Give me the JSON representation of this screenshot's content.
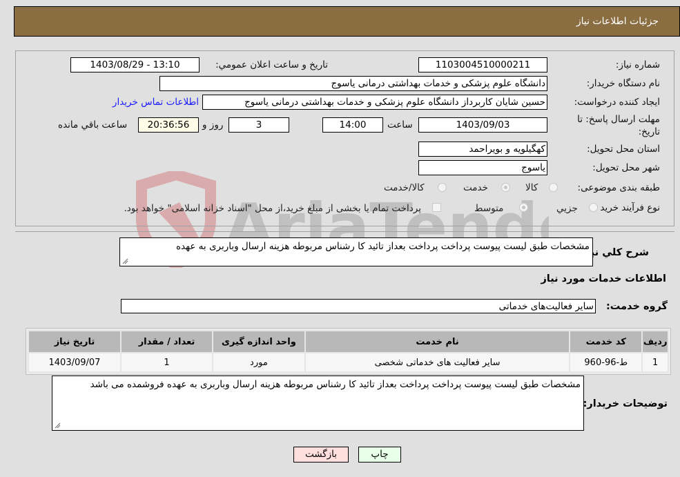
{
  "header": {
    "title": "جزئیات اطلاعات نیاز"
  },
  "form": {
    "need_number": {
      "label": "شماره نیاز:",
      "value": "1103004510000211"
    },
    "announce_datetime": {
      "label": "تاریخ و ساعت اعلان عمومي:",
      "value": "1403/08/29 - 13:10"
    },
    "buyer_org": {
      "label": "نام دستگاه خریدار:",
      "value": "دانشگاه علوم پزشکی و خدمات بهداشتی  درمانی یاسوج"
    },
    "requester": {
      "label": "ایجاد کننده درخواست:",
      "value": "حسین شایان کاربرداز دانشگاه علوم پزشکی و خدمات بهداشتی  درمانی یاسوج",
      "contact_link": "اطلاعات تماس خریدار"
    },
    "deadline": {
      "label": "مهلت ارسال پاسخ: تا تاریخ:",
      "date": "1403/09/03",
      "time_label": "ساعت",
      "time": "14:00",
      "days": "3",
      "days_label": "روز و",
      "remaining": "20:36:56",
      "remaining_label": "ساعت باقي مانده"
    },
    "province": {
      "label": "استان محل تحویل:",
      "value": "کهگیلویه و بویراحمد"
    },
    "city": {
      "label": "شهر محل تحویل:",
      "value": "یاسوج"
    },
    "category": {
      "label": "طبقه بندی موضوعی:",
      "options": [
        "کالا",
        "خدمت",
        "کالا/خدمت"
      ],
      "selected": "خدمت"
    },
    "purchase_type": {
      "label": "نوع فرآیند خرید :",
      "options": [
        "جزيي",
        "متوسط"
      ],
      "selected": "متوسط",
      "treasury_note": "پرداخت تمام یا بخشی از مبلغ خرید،از محل \"اسناد خزانه اسلامی\" خواهد بود."
    }
  },
  "general_description": {
    "label": "شرح کلي نیاز:",
    "value": "مشخصات طبق لیست پیوست پرداخت پرداخت بعداز تائید کا رشناس مربوطه هزینه ارسال وباربری به عهده"
  },
  "services_section": {
    "title": "اطلاعات خدمات مورد نیاز",
    "group_label": "گروه خدمت:",
    "group_value": "سایر فعالیت‌های خدماتی"
  },
  "table": {
    "headers": [
      "ردیف",
      "کد خدمت",
      "نام خدمت",
      "واحد اندازه گیری",
      "تعداد / مقدار",
      "تاریخ نیاز"
    ],
    "rows": [
      [
        "1",
        "ط-96-960",
        "سایر فعالیت های خدماتی شخصی",
        "مورد",
        "1",
        "1403/09/07"
      ]
    ]
  },
  "buyer_notes": {
    "label": "توضیحات خریدار:",
    "value": "مشخصات طبق لیست پیوست پرداخت پرداخت بعداز تائید کا رشناس مربوطه هزینه ارسال وباربری به عهده فروشمده می باشد"
  },
  "buttons": {
    "print": "چاپ",
    "back": "بازگشت"
  },
  "watermark": {
    "text": "AriaTender.neT"
  },
  "colors": {
    "header_bg": "#8b6d42",
    "print_bg": "#e8ffe8",
    "back_bg": "#ffdede",
    "link": "#1a1aff"
  }
}
